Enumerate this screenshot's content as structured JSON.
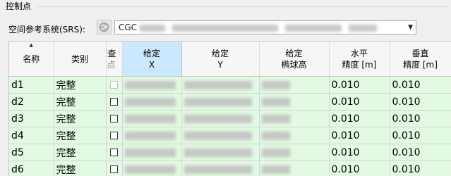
{
  "group": {
    "title": "控制点"
  },
  "srs": {
    "label": "空间参考系统(SRS):",
    "selected_value": "CGC",
    "icon": "globe-icon",
    "dropdown_icon": "chevron-down-icon"
  },
  "table": {
    "columns": [
      {
        "label": "名称",
        "label2": ""
      },
      {
        "label": "类别",
        "label2": ""
      },
      {
        "label": "检查",
        "label2": "点"
      },
      {
        "label": "给定",
        "label2": "X"
      },
      {
        "label": "给定",
        "label2": "Y"
      },
      {
        "label": "给定",
        "label2": "椭球高"
      },
      {
        "label": "水平",
        "label2": "精度 [m]"
      },
      {
        "label": "垂直",
        "label2": "精度 [m]"
      }
    ],
    "sort_indicator": "▲",
    "rows": [
      {
        "name": "d1",
        "category": "完整",
        "h_precision": "0.010",
        "v_precision": "0.010"
      },
      {
        "name": "d2",
        "category": "完整",
        "h_precision": "0.010",
        "v_precision": "0.010"
      },
      {
        "name": "d3",
        "category": "完整",
        "h_precision": "0.010",
        "v_precision": "0.010"
      },
      {
        "name": "d4",
        "category": "完整",
        "h_precision": "0.010",
        "v_precision": "0.010"
      },
      {
        "name": "d5",
        "category": "完整",
        "h_precision": "0.010",
        "v_precision": "0.010"
      },
      {
        "name": "d6",
        "category": "完整",
        "h_precision": "0.010",
        "v_precision": "0.010"
      }
    ]
  },
  "colors": {
    "row_background": "#e2f9e2",
    "selected_header": "#cce8ff"
  }
}
